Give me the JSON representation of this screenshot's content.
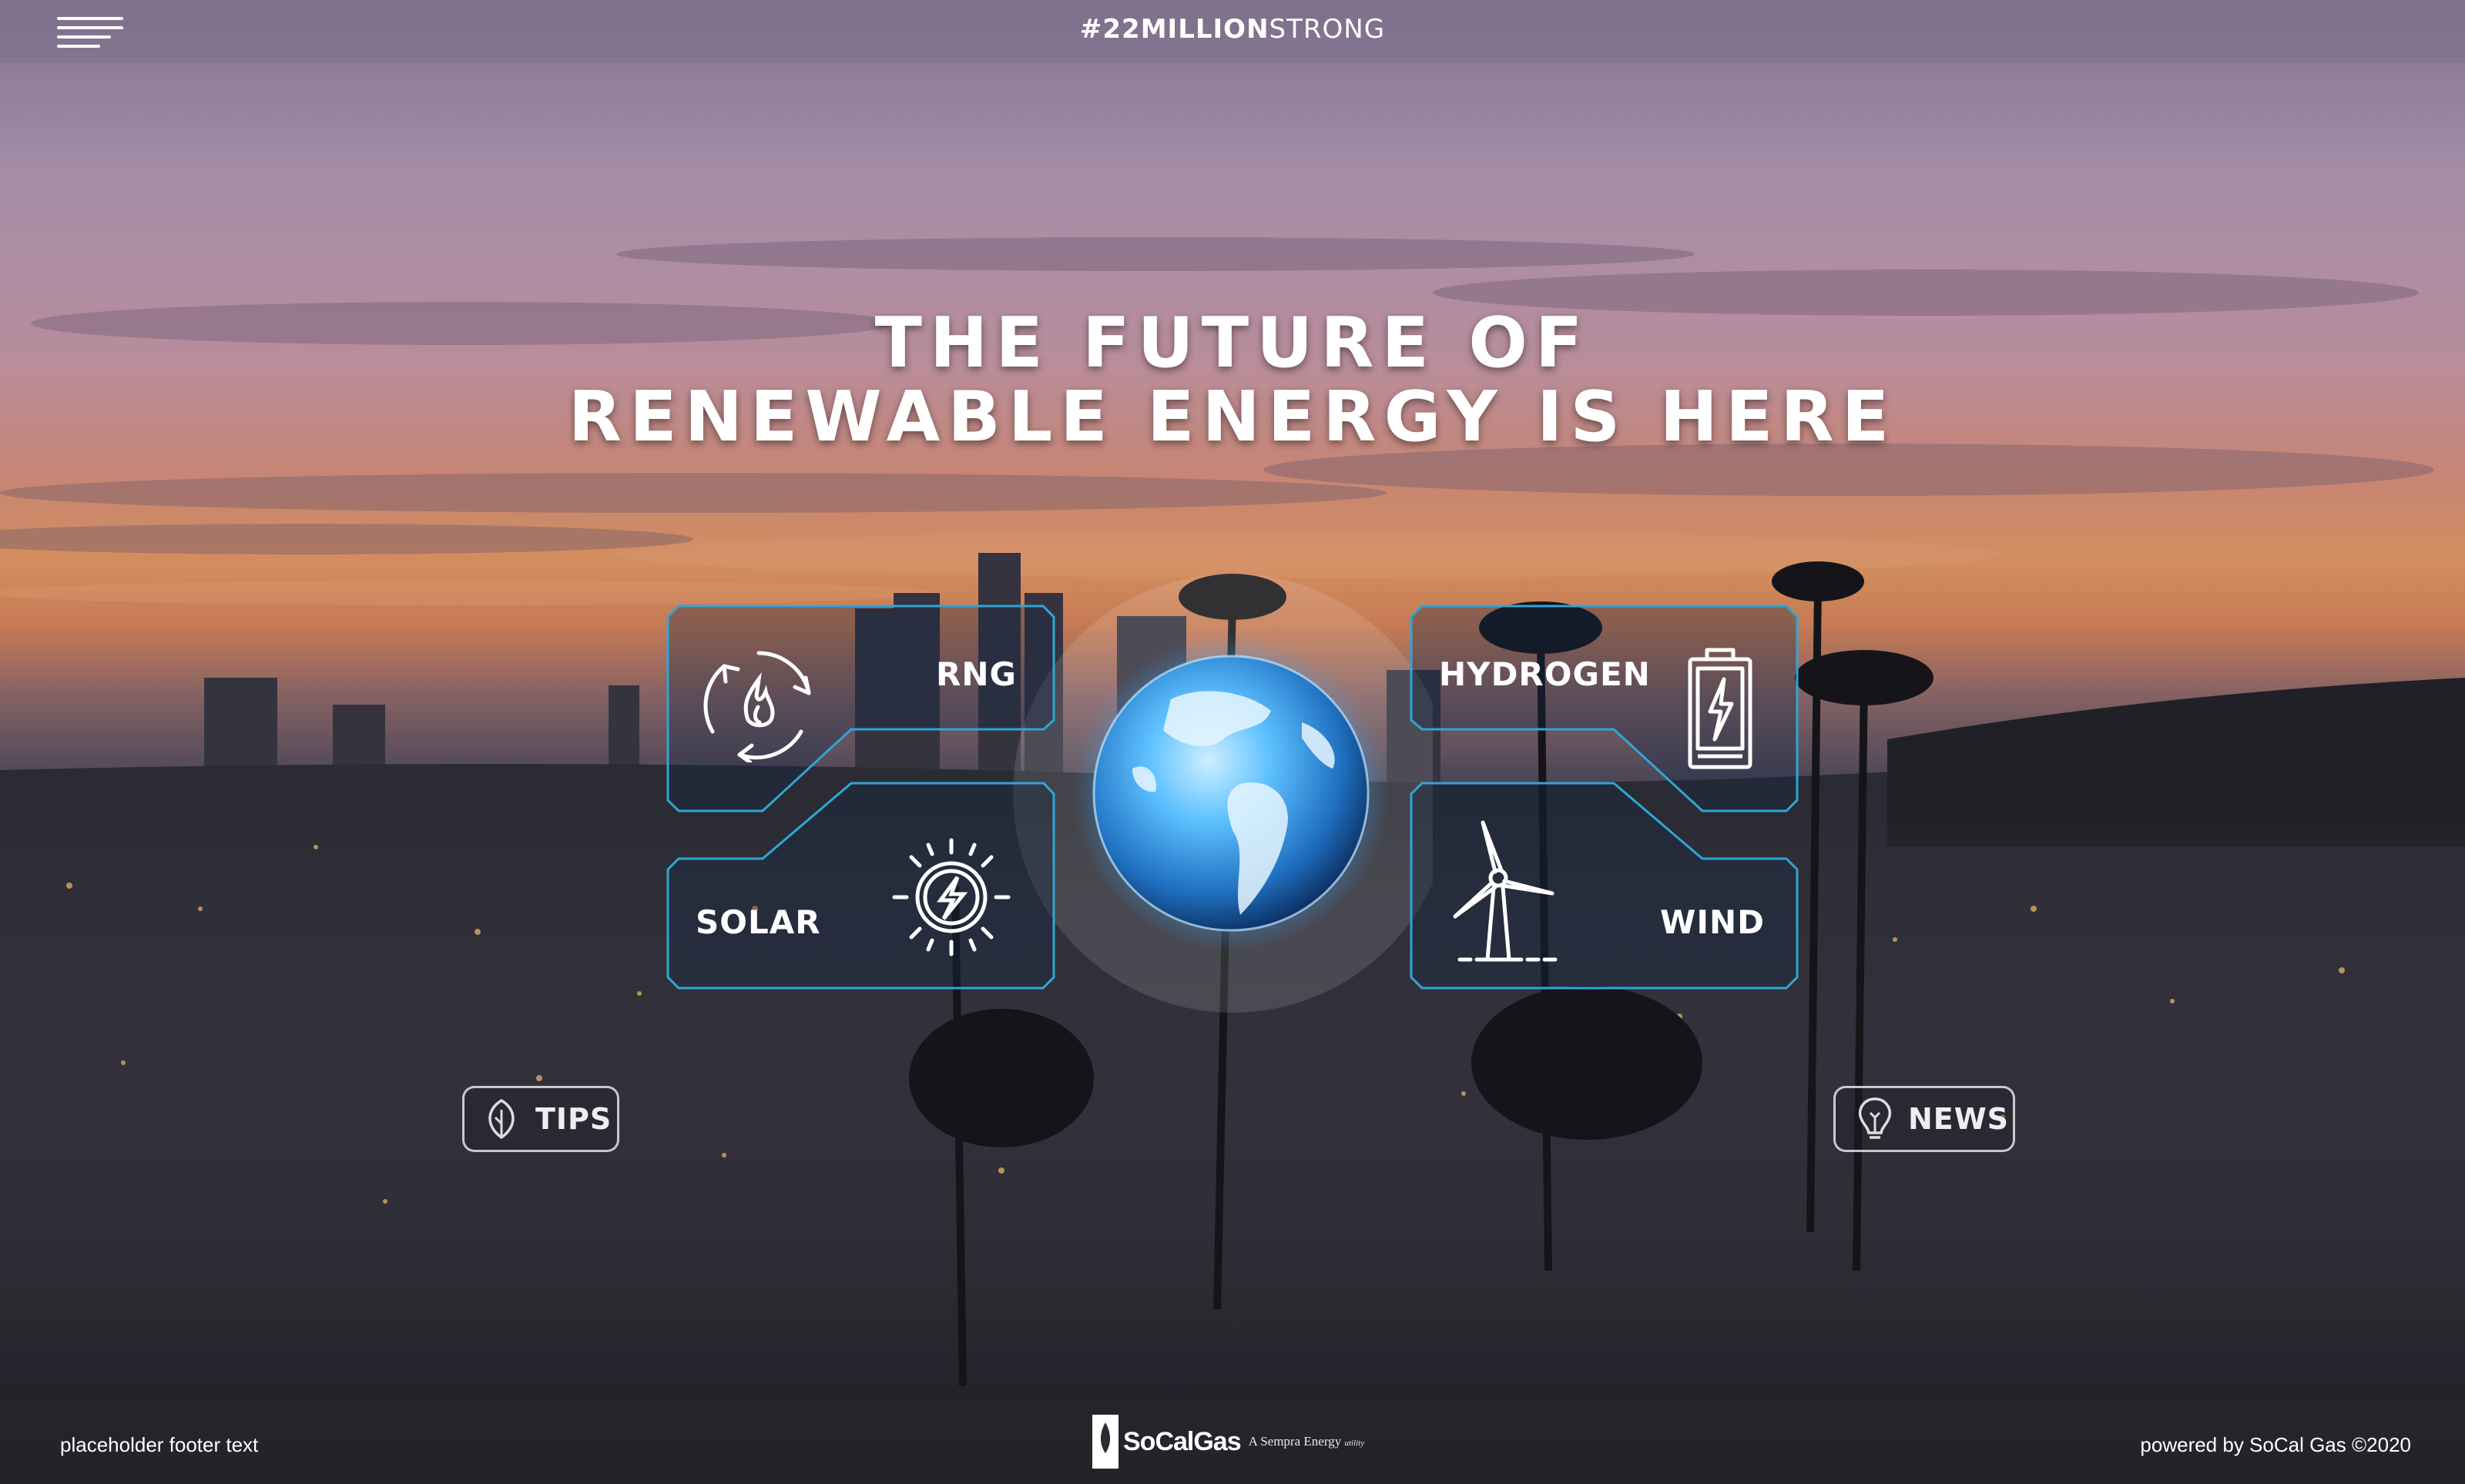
{
  "header": {
    "hashtag_bold": "#22MILLION",
    "hashtag_light": "STRONG",
    "menu_icon": "hamburger-menu-icon"
  },
  "hero": {
    "line1": "THE FUTURE OF",
    "line2": "RENEWABLE ENERGY IS HERE"
  },
  "tiles": [
    {
      "label": "RNG",
      "icon": "recycle-flame-icon"
    },
    {
      "label": "HYDROGEN",
      "icon": "battery-bolt-icon"
    },
    {
      "label": "SOLAR",
      "icon": "sun-bolt-icon"
    },
    {
      "label": "WIND",
      "icon": "wind-turbine-icon"
    }
  ],
  "center": {
    "icon": "globe-icon"
  },
  "buttons": {
    "tips": {
      "label": "TIPS",
      "icon": "leaf-icon"
    },
    "news": {
      "label": "NEWS",
      "icon": "lightbulb-icon"
    }
  },
  "footer": {
    "left_text": "placeholder footer text",
    "brand_name": "SoCalGas",
    "brand_sub": "A Sempra Energy",
    "brand_sub_small": "utility",
    "right_text": "powered by SoCal Gas ©2020"
  },
  "colors": {
    "panel_stroke": "#2fa6d6",
    "panel_fill": "rgba(20,40,70,0.35)",
    "globe_glow": "#3aa8ff"
  }
}
